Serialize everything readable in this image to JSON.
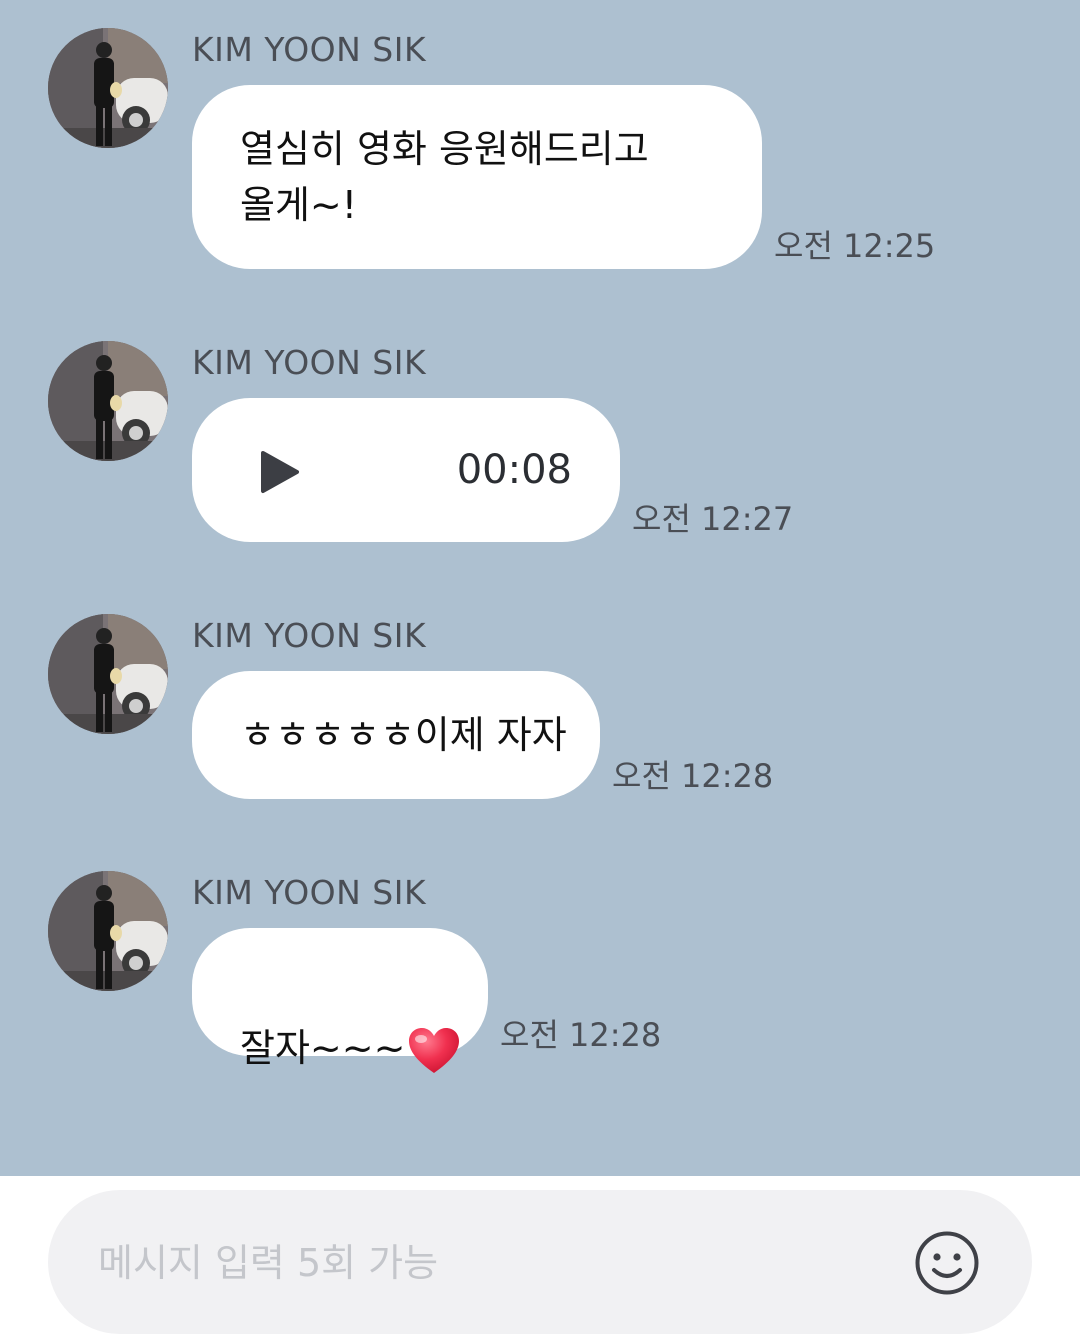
{
  "colors": {
    "chat_background": "#adc0d0",
    "bubble": "#ffffff",
    "input_bar": "#ffffff",
    "input_pill": "#f1f1f3",
    "heart": "#ee2a4c"
  },
  "messages": [
    {
      "sender": "KIM YOON SIK",
      "type": "text",
      "text": "열심히 영화 응원해드리고\n올게~!",
      "time": "오전 12:25"
    },
    {
      "sender": "KIM YOON SIK",
      "type": "voice",
      "icon": "play-icon",
      "duration": "00:08",
      "time": "오전 12:27"
    },
    {
      "sender": "KIM YOON SIK",
      "type": "text",
      "text": "ㅎㅎㅎㅎㅎ이제 자자",
      "time": "오전 12:28"
    },
    {
      "sender": "KIM YOON SIK",
      "type": "text",
      "text": "잘자~~~",
      "emoji": "heart-icon",
      "time": "오전 12:28"
    }
  ],
  "composer": {
    "placeholder": "메시지 입력 5회 가능",
    "value": "",
    "emoji_icon": "smiley-icon"
  }
}
